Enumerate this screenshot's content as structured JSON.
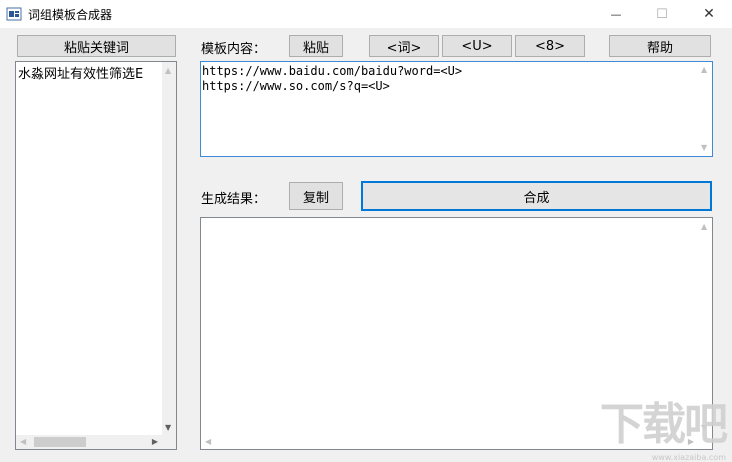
{
  "window": {
    "title": "词组模板合成器",
    "minimize_glyph": "—",
    "maximize_glyph": "☐",
    "close_glyph": "✕"
  },
  "left": {
    "paste_keywords_label": "粘贴关键词",
    "keywords": [
      "水淼网址有效性筛选E"
    ]
  },
  "template": {
    "label": "模板内容：",
    "paste_label": "粘贴",
    "insert_word_label": "<词>",
    "insert_u_label": "<U>",
    "insert_8_label": "<8>",
    "help_label": "帮助",
    "content": "https://www.baidu.com/baidu?word=<U>\nhttps://www.so.com/s?q=<U>"
  },
  "result": {
    "label": "生成结果：",
    "copy_label": "复制",
    "compose_label": "合成",
    "content": ""
  },
  "watermark": {
    "text": "下载吧",
    "site": "www.xiazaiba.com"
  },
  "icons": {
    "scroll_up": "▲",
    "scroll_down": "▼",
    "scroll_left": "◀",
    "scroll_right": "▶"
  }
}
